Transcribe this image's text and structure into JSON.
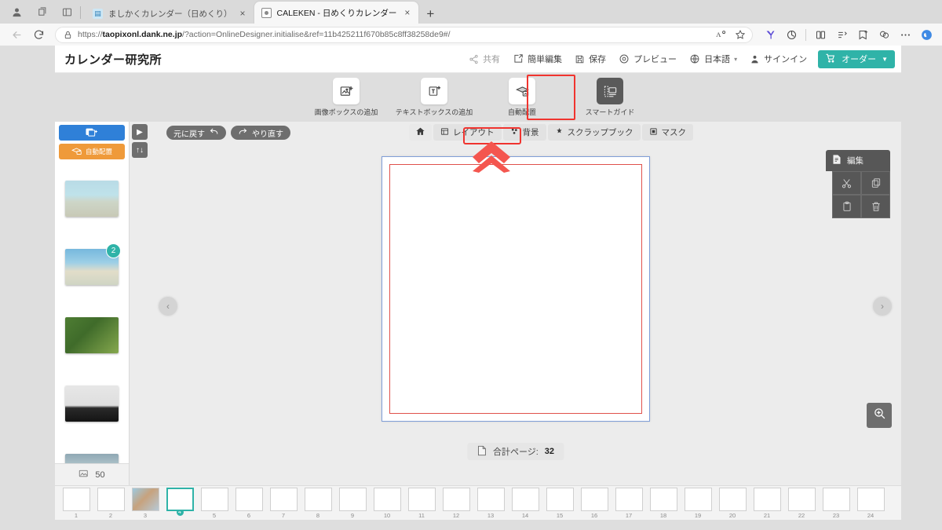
{
  "browser": {
    "toolbar_icons": [
      "profile-icon",
      "collections-icon",
      "split-screen-icon"
    ],
    "tabs": [
      {
        "title": "ましかくカレンダー（日めくり）",
        "favicon": "calendar-favicon",
        "active": false,
        "close_label": "×"
      },
      {
        "title": "CALEKEN - 日めくりカレンダー",
        "favicon": "caleken-favicon",
        "active": true,
        "close_label": "×"
      }
    ],
    "new_tab_label": "+",
    "nav": {
      "back": "back-arrow",
      "reload": "reload-icon"
    },
    "address": {
      "scheme": "https://",
      "host": "taopixonl.dank.ne.jp",
      "path": "/?action=OnlineDesigner.initialise&ref=11b425211f670b85c8ff38258de9#/",
      "lock": "lock-icon",
      "read_aloud": "read-aloud-icon",
      "favorite": "star-icon"
    },
    "extensions": [
      "yandex-icon",
      "ghost-icon",
      "split-icon",
      "collections-icon",
      "favorites-add-icon",
      "browser-essentials-icon",
      "more-icon",
      "copilot-icon"
    ]
  },
  "app": {
    "logo": "カレンダー研究所",
    "header_items": [
      {
        "label": "共有",
        "icon": "share-icon",
        "dim": true
      },
      {
        "label": "簡単編集",
        "icon": "easy-edit-icon",
        "dim": false
      },
      {
        "label": "保存",
        "icon": "save-icon",
        "dim": false
      },
      {
        "label": "プレビュー",
        "icon": "preview-icon",
        "dim": false
      },
      {
        "label": "日本語",
        "icon": "globe-icon",
        "dim": false,
        "caret": "▾"
      },
      {
        "label": "サインイン",
        "icon": "user-icon",
        "dim": false
      }
    ],
    "order_button": {
      "label": "オーダー",
      "icon": "cart-icon",
      "caret": "▼",
      "color": "#2fb3a8"
    }
  },
  "tools": [
    {
      "label": "画像ボックスの追加",
      "icon": "add-image-box-icon",
      "dark": false,
      "highlighted": false
    },
    {
      "label": "テキストボックスの追加",
      "icon": "add-text-box-icon",
      "dark": false,
      "highlighted": true
    },
    {
      "label": "自動配置",
      "icon": "auto-fill-icon",
      "dark": false,
      "highlighted": false
    },
    {
      "label": "スマートガイド",
      "icon": "smart-guide-icon",
      "dark": true,
      "highlighted": false
    }
  ],
  "photo_rail": {
    "add_images_label": "",
    "add_images_icon": "add-photos-icon",
    "auto_place_label": "自動配置",
    "auto_place_icon": "auto-place-icon",
    "thumbnails": [
      {
        "name": "beach-person",
        "class": "ph1",
        "badge": ""
      },
      {
        "name": "palm-beach",
        "class": "ph2",
        "badge": "2"
      },
      {
        "name": "red-flower",
        "class": "ph3",
        "badge": ""
      },
      {
        "name": "dark-building",
        "class": "ph4",
        "badge": ""
      },
      {
        "name": "coastal-view",
        "class": "ph5",
        "badge": ""
      }
    ],
    "count": "50",
    "count_icon": "photos-icon"
  },
  "sub_toolbar": {
    "sidebar_toggle": "▶",
    "reorder_toggle": "↑↓",
    "undo": {
      "label": "元に戻す",
      "icon": "undo-arrow-icon"
    },
    "redo": {
      "label": "やり直す",
      "icon": "redo-arrow-icon"
    },
    "tabs": [
      {
        "label": "",
        "icon": "home-icon",
        "name": "tab-home"
      },
      {
        "label": "レイアウト",
        "icon": "layout-icon",
        "name": "tab-layout"
      },
      {
        "label": "背景",
        "icon": "background-icon",
        "name": "tab-background"
      },
      {
        "label": "スクラップブック",
        "icon": "scrapbook-icon",
        "name": "tab-scrapbook"
      },
      {
        "label": "マスク",
        "icon": "mask-icon",
        "name": "tab-mask"
      }
    ]
  },
  "canvas": {
    "prev_arrow": "‹",
    "next_arrow": "›",
    "zoom_icon": "zoom-in-icon",
    "page_border_color": "#7f9ed8",
    "bleed_border_color": "#e0514b"
  },
  "edit_panel": {
    "title": "編集",
    "title_icon": "edit-page-icon",
    "actions": [
      {
        "name": "cut-icon",
        "glyph": "✂"
      },
      {
        "name": "copy-icon",
        "glyph": "copy"
      },
      {
        "name": "paste-icon",
        "glyph": "paste"
      },
      {
        "name": "delete-icon",
        "glyph": "trash"
      }
    ]
  },
  "total_pages": {
    "label": "合計ページ:",
    "value": "32",
    "icon": "pages-icon"
  },
  "page_strip": {
    "selected": 4,
    "pages": [
      {
        "num": "1"
      },
      {
        "num": "2"
      },
      {
        "num": "3"
      },
      {
        "num": "4"
      },
      {
        "num": "5"
      },
      {
        "num": "6"
      },
      {
        "num": "7"
      },
      {
        "num": "8"
      },
      {
        "num": "9"
      },
      {
        "num": "10"
      },
      {
        "num": "11"
      },
      {
        "num": "12"
      },
      {
        "num": "13"
      },
      {
        "num": "14"
      },
      {
        "num": "15"
      },
      {
        "num": "16"
      },
      {
        "num": "17"
      },
      {
        "num": "18"
      },
      {
        "num": "19"
      },
      {
        "num": "20"
      },
      {
        "num": "21"
      },
      {
        "num": "22"
      },
      {
        "num": "23"
      },
      {
        "num": "24"
      }
    ]
  },
  "annotations": {
    "chevron_color": "#f4564f",
    "highlight_color": "#f0342f"
  }
}
